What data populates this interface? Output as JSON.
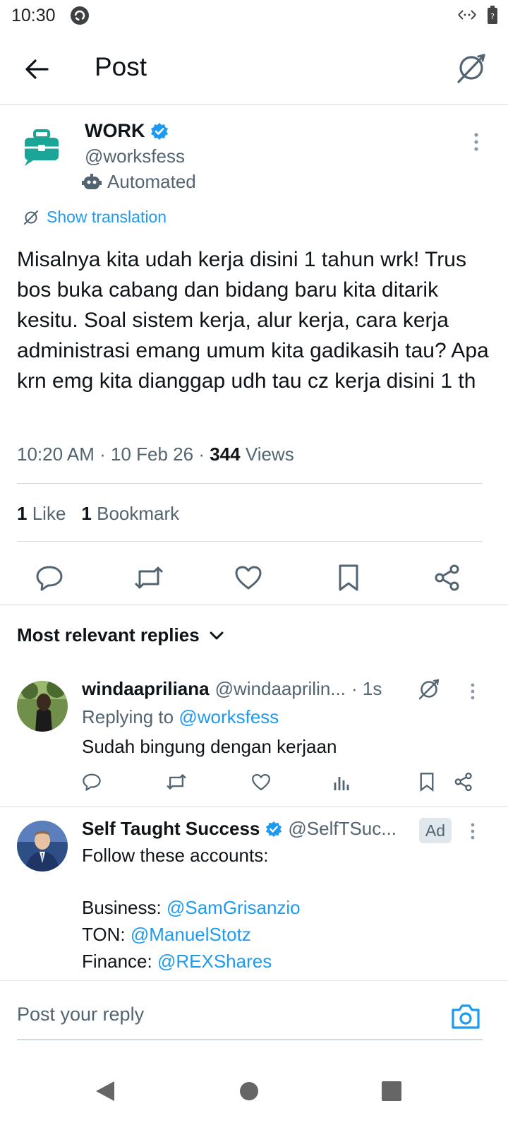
{
  "status_bar": {
    "time": "10:30"
  },
  "header": {
    "title": "Post"
  },
  "post": {
    "author_name": "WORK",
    "author_handle": "@worksfess",
    "automated_label": "Automated",
    "show_translation": "Show translation",
    "text": "Misalnya kita udah kerja disini 1 tahun wrk! Trus bos buka cabang dan bidang baru kita ditarik kesitu. Soal sistem kerja, alur kerja, cara kerja administrasi emang umum kita gadikasih tau? Apa krn emg kita dianggap udh tau cz kerja disini 1 th",
    "time": "10:20 AM",
    "date": "10 Feb 26",
    "views_count": "344",
    "views_label": "Views",
    "likes_count": "1",
    "likes_label": "Like",
    "bookmarks_count": "1",
    "bookmarks_label": "Bookmark"
  },
  "replies": {
    "sort_label": "Most relevant replies",
    "items": [
      {
        "name": "windaapriliana",
        "handle": "@windaaprilin...",
        "time": "· 1s",
        "replying_to_label": "Replying to",
        "replying_to_handle": "@worksfess",
        "text": "Sudah bingung dengan kerjaan"
      }
    ],
    "ad": {
      "name": "Self Taught Success",
      "handle": "@SelfTSuc...",
      "badge": "Ad",
      "intro": "Follow these accounts:",
      "lines": [
        {
          "label": "Business:",
          "handle": "@SamGrisanzio"
        },
        {
          "label": "TON:",
          "handle": "@ManuelStotz"
        },
        {
          "label": "Finance:",
          "handle": "@REXShares"
        }
      ]
    }
  },
  "composer": {
    "placeholder": "Post your reply"
  },
  "colors": {
    "accent": "#1d9bf0",
    "text": "#0f1419",
    "muted": "#536471",
    "brand_icon": "#1aa597"
  },
  "icons": {
    "back": "arrow-left-icon",
    "translate": "translate-icon",
    "reply": "reply-icon",
    "repost": "repost-icon",
    "like": "heart-icon",
    "bookmark": "bookmark-icon",
    "share": "share-icon",
    "camera": "camera-icon"
  }
}
